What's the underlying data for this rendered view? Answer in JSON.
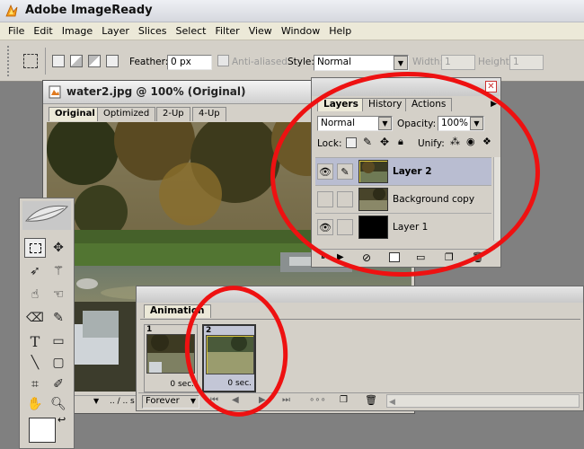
{
  "app": {
    "title": "Adobe ImageReady"
  },
  "menu": [
    "File",
    "Edit",
    "Image",
    "Layer",
    "Slices",
    "Select",
    "Filter",
    "View",
    "Window",
    "Help"
  ],
  "options_bar": {
    "feather_label": "Feather:",
    "feather_value": "0 px",
    "anti_aliased_label": "Anti-aliased",
    "style_label": "Style:",
    "style_value": "Normal",
    "width_label": "Width:",
    "width_value": "1",
    "height_label": "Height:",
    "height_value": "1"
  },
  "document": {
    "title": "water2.jpg @ 100% (Original)",
    "tabs": [
      "Original",
      "Optimized",
      "2-Up",
      "4-Up"
    ],
    "status": ".. / .. s"
  },
  "layers_palette": {
    "tabs": [
      "Layers",
      "History",
      "Actions"
    ],
    "blend_mode": "Normal",
    "opacity_label": "Opacity:",
    "opacity_value": "100%",
    "lock_label": "Lock:",
    "unify_label": "Unify:",
    "layers": [
      {
        "name": "Layer 2",
        "visible": true,
        "selected": true
      },
      {
        "name": "Background copy",
        "visible": false,
        "selected": false
      },
      {
        "name": "Layer 1",
        "visible": true,
        "selected": false
      }
    ]
  },
  "animation_palette": {
    "tab": "Animation",
    "frames": [
      {
        "number": "1",
        "delay": "0 sec."
      },
      {
        "number": "2",
        "delay": "0 sec."
      }
    ],
    "loop": "Forever"
  },
  "colors": {
    "annotation": "#e11111",
    "selection_blue": "#9aa3c0",
    "workspace": "#808080"
  }
}
